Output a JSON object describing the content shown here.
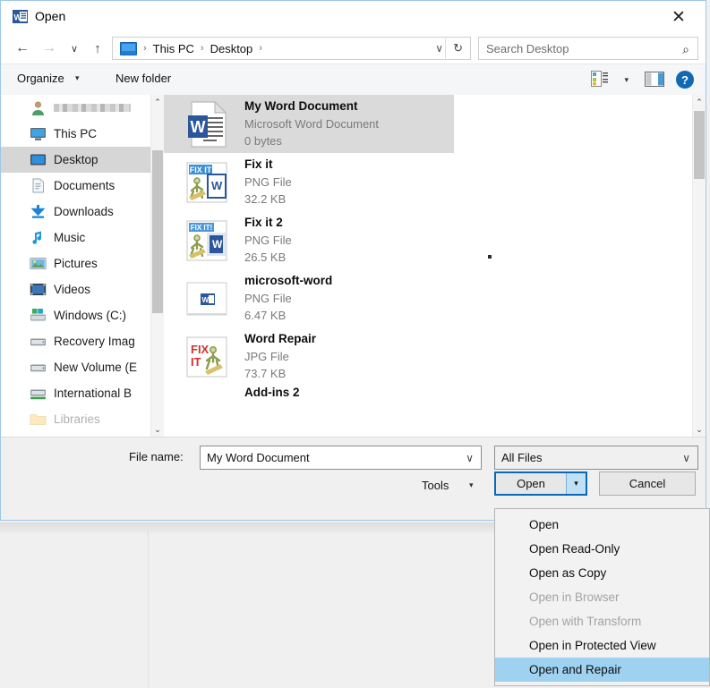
{
  "window": {
    "title": "Open",
    "app_icon": "word-icon",
    "close_label": "✕"
  },
  "nav": {
    "back_icon": "←",
    "forward_icon": "→",
    "recent_icon": "∨",
    "up_icon": "↑",
    "address": {
      "icon": "desktop-icon",
      "crumbs": [
        "This PC",
        "Desktop"
      ],
      "separator": "›",
      "trailing_separator": "›",
      "dropdown_icon": "∨",
      "refresh_icon": "↻"
    },
    "search": {
      "placeholder": "Search Desktop",
      "icon": "⌕"
    }
  },
  "commandbar": {
    "organize_label": "Organize",
    "organize_caret": "▾",
    "new_folder_label": "New folder",
    "view_caret": "▾",
    "help_label": "?"
  },
  "sidebar": {
    "items": [
      {
        "label": "",
        "icon": "user-account-icon",
        "redacted": true,
        "selected": false,
        "faded": false
      },
      {
        "label": "This PC",
        "icon": "this-pc-icon",
        "redacted": false,
        "selected": false,
        "faded": false
      },
      {
        "label": "Desktop",
        "icon": "desktop-icon",
        "redacted": false,
        "selected": true,
        "faded": false
      },
      {
        "label": "Documents",
        "icon": "documents-icon",
        "redacted": false,
        "selected": false,
        "faded": false
      },
      {
        "label": "Downloads",
        "icon": "downloads-icon",
        "redacted": false,
        "selected": false,
        "faded": false
      },
      {
        "label": "Music",
        "icon": "music-icon",
        "redacted": false,
        "selected": false,
        "faded": false
      },
      {
        "label": "Pictures",
        "icon": "pictures-icon",
        "redacted": false,
        "selected": false,
        "faded": false
      },
      {
        "label": "Videos",
        "icon": "videos-icon",
        "redacted": false,
        "selected": false,
        "faded": false
      },
      {
        "label": "Windows (C:)",
        "icon": "drive-windows-icon",
        "redacted": false,
        "selected": false,
        "faded": false
      },
      {
        "label": "Recovery Imag",
        "icon": "drive-icon",
        "redacted": false,
        "selected": false,
        "faded": false
      },
      {
        "label": "New Volume (E",
        "icon": "drive-icon",
        "redacted": false,
        "selected": false,
        "faded": false
      },
      {
        "label": "International B",
        "icon": "network-drive-icon",
        "redacted": false,
        "selected": false,
        "faded": false
      },
      {
        "label": "Libraries",
        "icon": "folder-icon",
        "redacted": false,
        "selected": false,
        "faded": true
      }
    ],
    "scroll_up_icon": "⌃",
    "scroll_down_icon": "⌄"
  },
  "filelist": {
    "scroll_up_icon": "⌃",
    "scroll_down_icon": "⌄",
    "files": [
      {
        "name": "My Word Document",
        "type": "Microsoft Word Document",
        "size": "0 bytes",
        "icon": "word-document-icon",
        "selected": true
      },
      {
        "name": "Fix it",
        "type": "PNG File",
        "size": "32.2 KB",
        "icon": "fixit-word-icon",
        "selected": false
      },
      {
        "name": "Fix it 2",
        "type": "PNG File",
        "size": "26.5 KB",
        "icon": "fixit2-word-icon",
        "selected": false
      },
      {
        "name": "microsoft-word",
        "type": "PNG File",
        "size": "6.47 KB",
        "icon": "microsoft-word-icon",
        "selected": false
      },
      {
        "name": "Word Repair",
        "type": "JPG File",
        "size": "73.7 KB",
        "icon": "word-repair-icon",
        "selected": false
      }
    ],
    "partial_file": {
      "name": "Add-ins 2"
    }
  },
  "form": {
    "filename_label": "File name:",
    "filename_value": "My Word Document",
    "filename_caret": "∨",
    "filetype_value": "All Files",
    "filetype_caret": "∨",
    "tools_label": "Tools",
    "tools_caret": "▾",
    "open_label": "Open",
    "open_split_caret": "▾",
    "cancel_label": "Cancel"
  },
  "open_menu": {
    "items": [
      {
        "label": "Open",
        "disabled": false,
        "highlighted": false
      },
      {
        "label": "Open Read-Only",
        "disabled": false,
        "highlighted": false
      },
      {
        "label": "Open as Copy",
        "disabled": false,
        "highlighted": false
      },
      {
        "label": "Open in Browser",
        "disabled": true,
        "highlighted": false
      },
      {
        "label": "Open with Transform",
        "disabled": true,
        "highlighted": false
      },
      {
        "label": "Open in Protected View",
        "disabled": false,
        "highlighted": false
      },
      {
        "label": "Open and Repair",
        "disabled": false,
        "highlighted": true
      }
    ]
  },
  "colors": {
    "accent_blue": "#0a69b7",
    "menu_highlight": "#9fd1f0",
    "selection_gray": "#d6d6d6",
    "dialog_border": "#9ec7e8"
  }
}
